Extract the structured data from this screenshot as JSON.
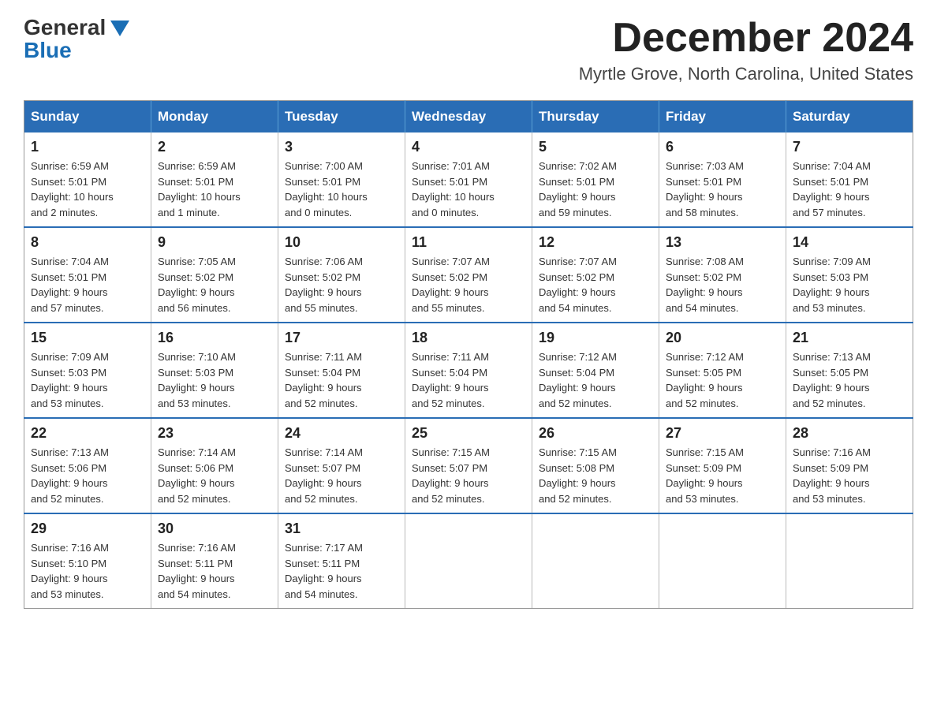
{
  "header": {
    "logo": {
      "general": "General",
      "blue": "Blue",
      "tagline": ""
    },
    "month_title": "December 2024",
    "location": "Myrtle Grove, North Carolina, United States"
  },
  "calendar": {
    "days_of_week": [
      "Sunday",
      "Monday",
      "Tuesday",
      "Wednesday",
      "Thursday",
      "Friday",
      "Saturday"
    ],
    "weeks": [
      [
        {
          "day": "1",
          "info": "Sunrise: 6:59 AM\nSunset: 5:01 PM\nDaylight: 10 hours\nand 2 minutes."
        },
        {
          "day": "2",
          "info": "Sunrise: 6:59 AM\nSunset: 5:01 PM\nDaylight: 10 hours\nand 1 minute."
        },
        {
          "day": "3",
          "info": "Sunrise: 7:00 AM\nSunset: 5:01 PM\nDaylight: 10 hours\nand 0 minutes."
        },
        {
          "day": "4",
          "info": "Sunrise: 7:01 AM\nSunset: 5:01 PM\nDaylight: 10 hours\nand 0 minutes."
        },
        {
          "day": "5",
          "info": "Sunrise: 7:02 AM\nSunset: 5:01 PM\nDaylight: 9 hours\nand 59 minutes."
        },
        {
          "day": "6",
          "info": "Sunrise: 7:03 AM\nSunset: 5:01 PM\nDaylight: 9 hours\nand 58 minutes."
        },
        {
          "day": "7",
          "info": "Sunrise: 7:04 AM\nSunset: 5:01 PM\nDaylight: 9 hours\nand 57 minutes."
        }
      ],
      [
        {
          "day": "8",
          "info": "Sunrise: 7:04 AM\nSunset: 5:01 PM\nDaylight: 9 hours\nand 57 minutes."
        },
        {
          "day": "9",
          "info": "Sunrise: 7:05 AM\nSunset: 5:02 PM\nDaylight: 9 hours\nand 56 minutes."
        },
        {
          "day": "10",
          "info": "Sunrise: 7:06 AM\nSunset: 5:02 PM\nDaylight: 9 hours\nand 55 minutes."
        },
        {
          "day": "11",
          "info": "Sunrise: 7:07 AM\nSunset: 5:02 PM\nDaylight: 9 hours\nand 55 minutes."
        },
        {
          "day": "12",
          "info": "Sunrise: 7:07 AM\nSunset: 5:02 PM\nDaylight: 9 hours\nand 54 minutes."
        },
        {
          "day": "13",
          "info": "Sunrise: 7:08 AM\nSunset: 5:02 PM\nDaylight: 9 hours\nand 54 minutes."
        },
        {
          "day": "14",
          "info": "Sunrise: 7:09 AM\nSunset: 5:03 PM\nDaylight: 9 hours\nand 53 minutes."
        }
      ],
      [
        {
          "day": "15",
          "info": "Sunrise: 7:09 AM\nSunset: 5:03 PM\nDaylight: 9 hours\nand 53 minutes."
        },
        {
          "day": "16",
          "info": "Sunrise: 7:10 AM\nSunset: 5:03 PM\nDaylight: 9 hours\nand 53 minutes."
        },
        {
          "day": "17",
          "info": "Sunrise: 7:11 AM\nSunset: 5:04 PM\nDaylight: 9 hours\nand 52 minutes."
        },
        {
          "day": "18",
          "info": "Sunrise: 7:11 AM\nSunset: 5:04 PM\nDaylight: 9 hours\nand 52 minutes."
        },
        {
          "day": "19",
          "info": "Sunrise: 7:12 AM\nSunset: 5:04 PM\nDaylight: 9 hours\nand 52 minutes."
        },
        {
          "day": "20",
          "info": "Sunrise: 7:12 AM\nSunset: 5:05 PM\nDaylight: 9 hours\nand 52 minutes."
        },
        {
          "day": "21",
          "info": "Sunrise: 7:13 AM\nSunset: 5:05 PM\nDaylight: 9 hours\nand 52 minutes."
        }
      ],
      [
        {
          "day": "22",
          "info": "Sunrise: 7:13 AM\nSunset: 5:06 PM\nDaylight: 9 hours\nand 52 minutes."
        },
        {
          "day": "23",
          "info": "Sunrise: 7:14 AM\nSunset: 5:06 PM\nDaylight: 9 hours\nand 52 minutes."
        },
        {
          "day": "24",
          "info": "Sunrise: 7:14 AM\nSunset: 5:07 PM\nDaylight: 9 hours\nand 52 minutes."
        },
        {
          "day": "25",
          "info": "Sunrise: 7:15 AM\nSunset: 5:07 PM\nDaylight: 9 hours\nand 52 minutes."
        },
        {
          "day": "26",
          "info": "Sunrise: 7:15 AM\nSunset: 5:08 PM\nDaylight: 9 hours\nand 52 minutes."
        },
        {
          "day": "27",
          "info": "Sunrise: 7:15 AM\nSunset: 5:09 PM\nDaylight: 9 hours\nand 53 minutes."
        },
        {
          "day": "28",
          "info": "Sunrise: 7:16 AM\nSunset: 5:09 PM\nDaylight: 9 hours\nand 53 minutes."
        }
      ],
      [
        {
          "day": "29",
          "info": "Sunrise: 7:16 AM\nSunset: 5:10 PM\nDaylight: 9 hours\nand 53 minutes."
        },
        {
          "day": "30",
          "info": "Sunrise: 7:16 AM\nSunset: 5:11 PM\nDaylight: 9 hours\nand 54 minutes."
        },
        {
          "day": "31",
          "info": "Sunrise: 7:17 AM\nSunset: 5:11 PM\nDaylight: 9 hours\nand 54 minutes."
        },
        {
          "day": "",
          "info": ""
        },
        {
          "day": "",
          "info": ""
        },
        {
          "day": "",
          "info": ""
        },
        {
          "day": "",
          "info": ""
        }
      ]
    ]
  }
}
